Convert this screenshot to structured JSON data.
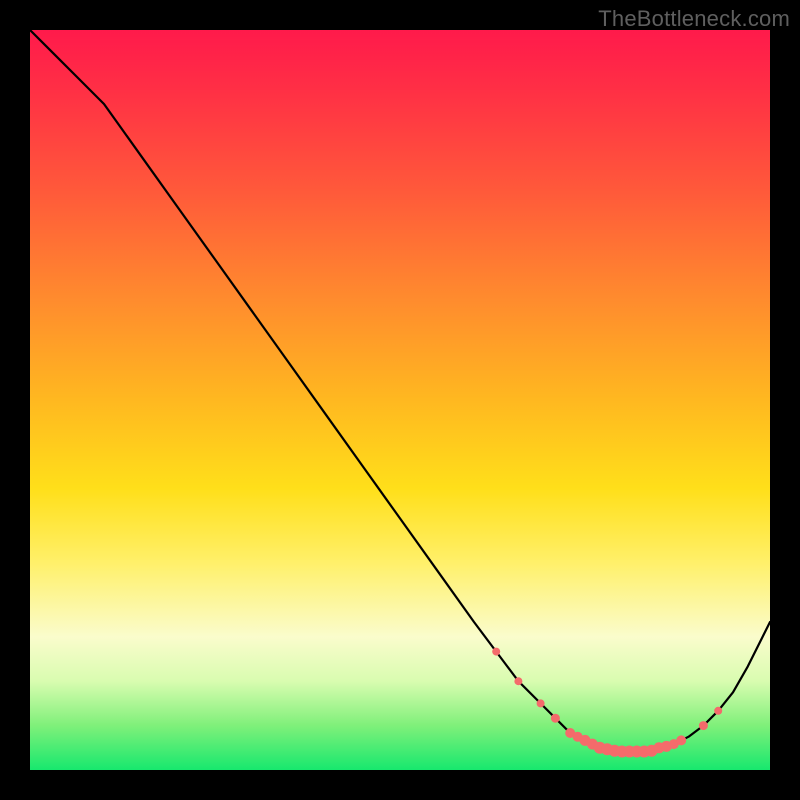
{
  "attribution": "TheBottleneck.com",
  "colors": {
    "frame": "#000000",
    "curve": "#000000",
    "dots": "#f46b6b"
  },
  "chart_data": {
    "type": "line",
    "title": "",
    "xlabel": "",
    "ylabel": "",
    "xlim": [
      0,
      100
    ],
    "ylim": [
      0,
      100
    ],
    "grid": false,
    "legend": false,
    "series": [
      {
        "name": "bottleneck-curve",
        "x": [
          0,
          3,
          6,
          10,
          15,
          20,
          25,
          30,
          35,
          40,
          45,
          50,
          55,
          60,
          63,
          66,
          69,
          71,
          73,
          75,
          77,
          79,
          81,
          83,
          85,
          87,
          89,
          91,
          93,
          95,
          97,
          100
        ],
        "y": [
          100,
          97,
          94,
          90,
          83,
          76,
          69,
          62,
          55,
          48,
          41,
          34,
          27,
          20,
          16,
          12,
          9,
          7,
          5,
          4,
          3,
          2.5,
          2.5,
          2.5,
          3,
          3.5,
          4.5,
          6,
          8,
          10.5,
          14,
          20
        ]
      }
    ],
    "highlight_points": {
      "name": "flat-region-dots",
      "x": [
        63,
        66,
        69,
        71,
        73,
        74,
        75,
        76,
        77,
        78,
        79,
        80,
        81,
        82,
        83,
        84,
        85,
        86,
        87,
        88,
        91,
        93
      ],
      "y": [
        16,
        12,
        9,
        7,
        5,
        4.5,
        4,
        3.5,
        3,
        2.8,
        2.6,
        2.5,
        2.5,
        2.5,
        2.5,
        2.6,
        3,
        3.2,
        3.5,
        4,
        6,
        8
      ],
      "r": [
        4,
        4,
        4,
        4.5,
        5,
        5,
        5.5,
        5.5,
        6,
        6,
        6,
        6,
        6,
        6,
        6,
        6,
        5.5,
        5.5,
        5,
        5,
        4.5,
        4
      ]
    }
  }
}
